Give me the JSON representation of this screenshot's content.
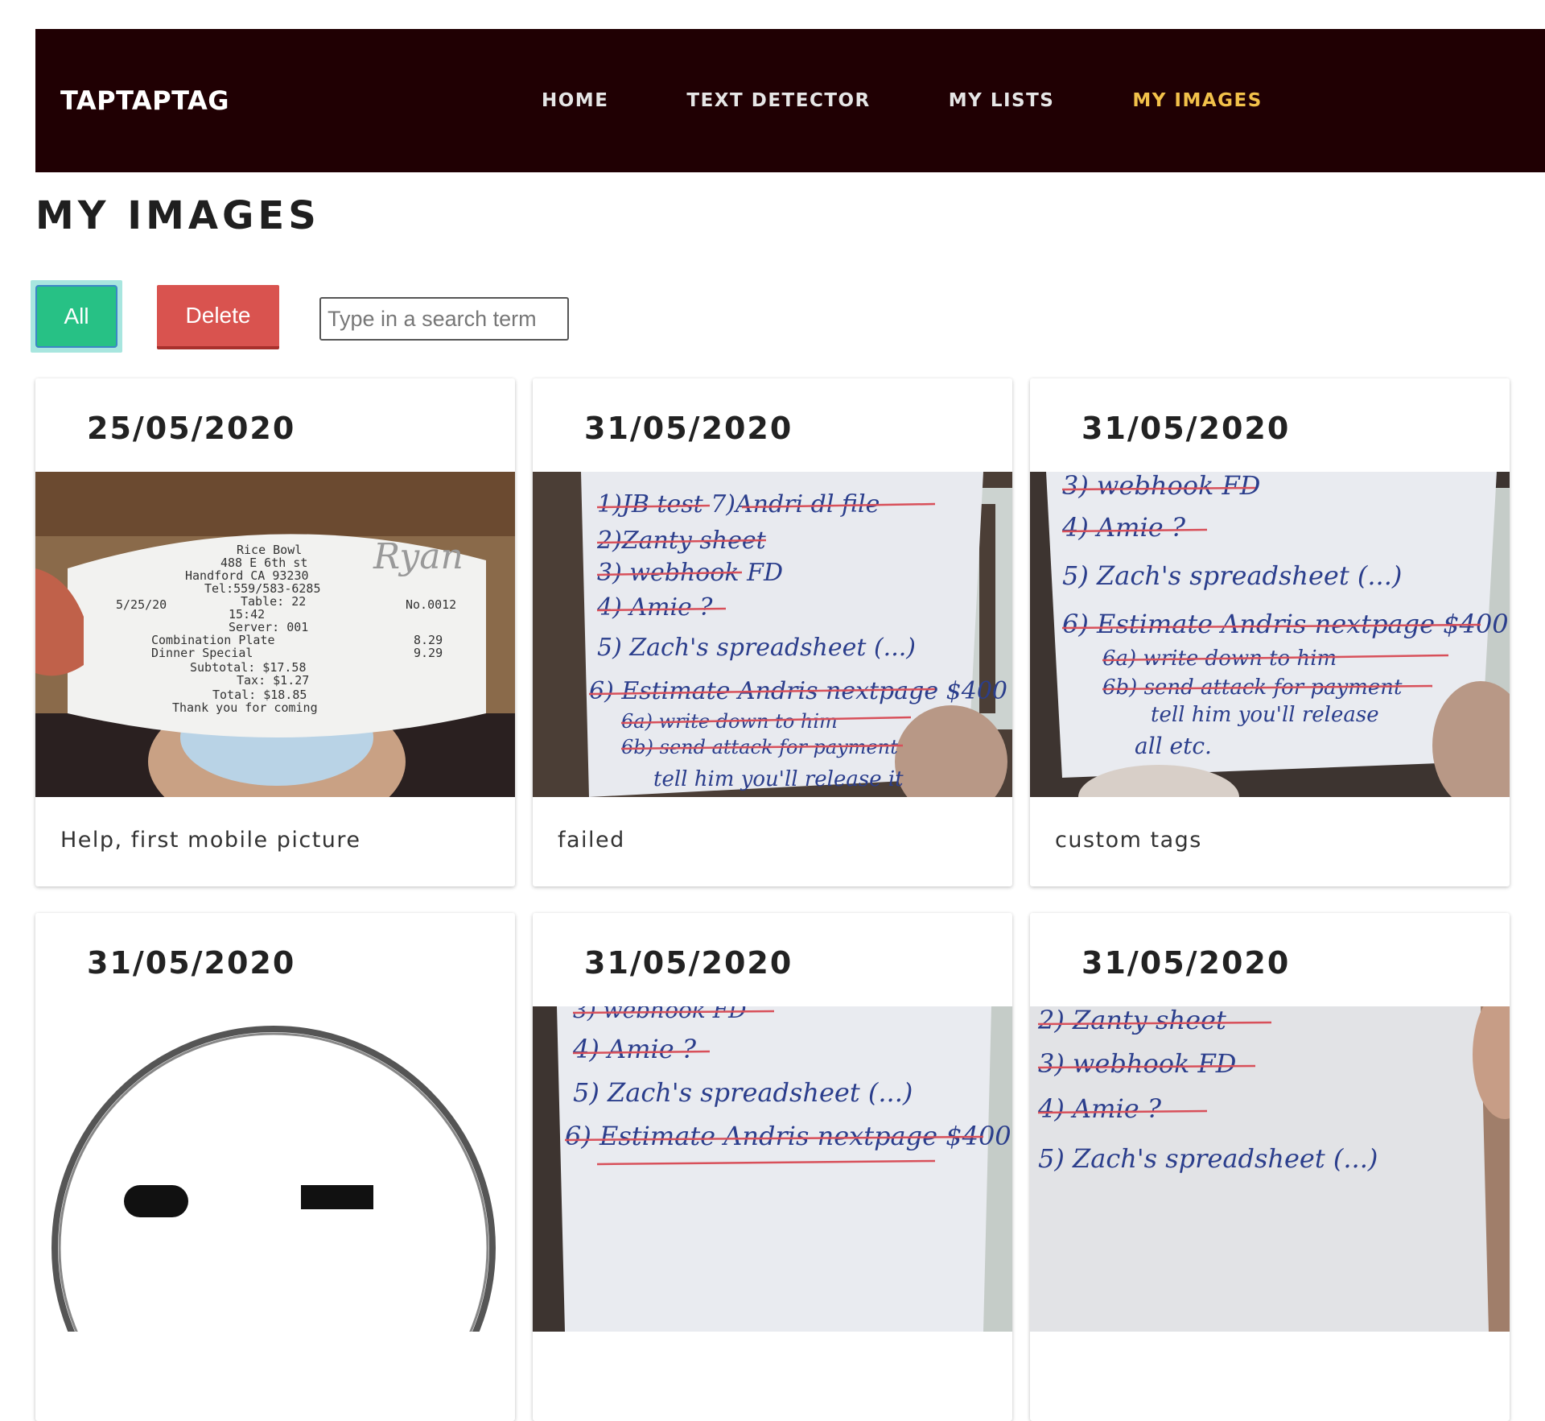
{
  "navbar": {
    "brand": "TAPTAPTAG",
    "links": [
      {
        "label": "HOME",
        "active": false
      },
      {
        "label": "TEXT DETECTOR",
        "active": false
      },
      {
        "label": "MY LISTS",
        "active": false
      },
      {
        "label": "MY IMAGES",
        "active": true
      }
    ],
    "background_color": "#200003",
    "active_color": "#f2c14a"
  },
  "page": {
    "title": "MY IMAGES"
  },
  "controls": {
    "all_label": "All",
    "delete_label": "Delete",
    "search_placeholder": "Type in a search term",
    "search_value": ""
  },
  "cards": [
    {
      "date": "25/05/2020",
      "caption": "Help, first mobile picture",
      "image": "receipt-photo"
    },
    {
      "date": "31/05/2020",
      "caption": "failed",
      "image": "handwritten-list-photo"
    },
    {
      "date": "31/05/2020",
      "caption": "custom tags",
      "image": "handwritten-list-photo"
    },
    {
      "date": "31/05/2020",
      "caption": "",
      "image": "circle-logo"
    },
    {
      "date": "31/05/2020",
      "caption": "",
      "image": "handwritten-list-photo"
    },
    {
      "date": "31/05/2020",
      "caption": "",
      "image": "handwritten-list-photo"
    }
  ]
}
